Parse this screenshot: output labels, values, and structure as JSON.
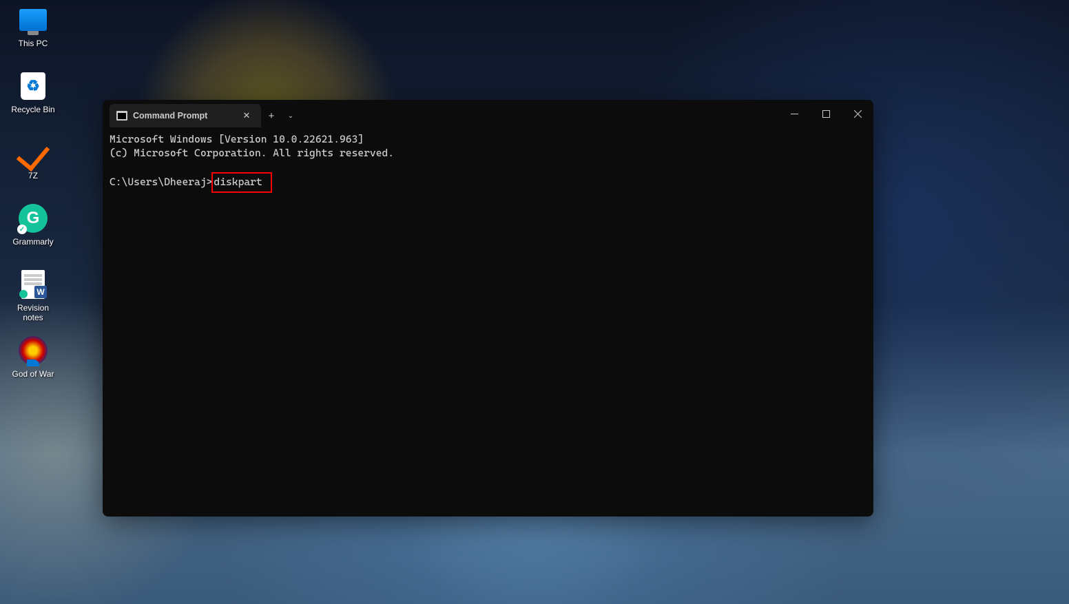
{
  "desktop": {
    "icons": [
      {
        "label": "This PC",
        "name": "this-pc-icon"
      },
      {
        "label": "Recycle Bin",
        "name": "recycle-bin-icon",
        "glyph": "♻"
      },
      {
        "label": "7Z",
        "name": "seven-z-icon"
      },
      {
        "label": "Grammarly",
        "name": "grammarly-icon",
        "glyph": "G"
      },
      {
        "label": "Revision notes",
        "name": "revision-notes-icon"
      },
      {
        "label": "God of War",
        "name": "god-of-war-icon"
      }
    ]
  },
  "terminal": {
    "tab_title": "Command Prompt",
    "lines": {
      "line1": "Microsoft Windows [Version 10.0.22621.963]",
      "line2": "(c) Microsoft Corporation. All rights reserved.",
      "prompt": "C:\\Users\\Dheeraj>",
      "command": "diskpart"
    },
    "window_controls": {
      "minimize": "—",
      "maximize": "□",
      "close": "✕"
    },
    "newtab": "+",
    "dropdown": "⌄",
    "tab_close": "✕"
  }
}
